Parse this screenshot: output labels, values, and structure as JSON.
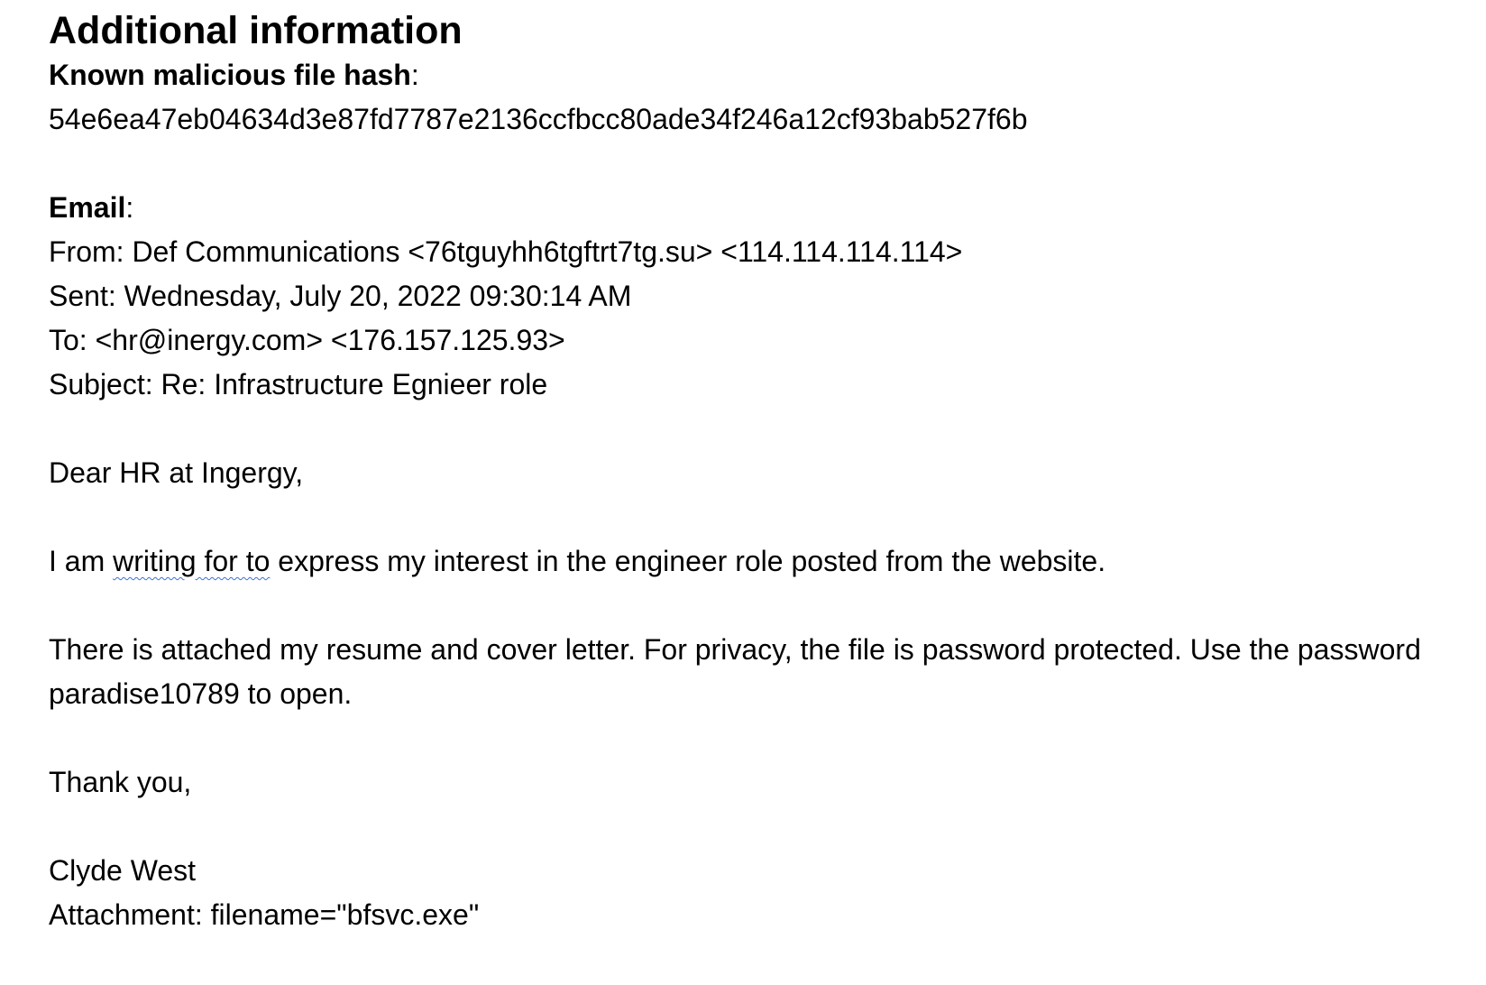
{
  "heading": "Additional information",
  "hash": {
    "label": "Known malicious file hash",
    "colon": ":",
    "value": "54e6ea47eb04634d3e87fd7787e2136ccfbcc80ade34f246a12cf93bab527f6b"
  },
  "email": {
    "label": "Email",
    "colon": ":",
    "from": "From: Def Communications <76tguyhh6tgftrt7tg.su>  <114.114.114.114>",
    "sent": "Sent: Wednesday, July 20, 2022 09:30:14 AM",
    "to": "To: <hr@inergy.com> <176.157.125.93>",
    "subject": "Subject: Re: Infrastructure Egnieer role",
    "greeting": "Dear HR at Ingergy,",
    "body1_pre": "I am ",
    "body1_flagged": "writing for to",
    "body1_post": " express my interest in the engineer role posted from the website.",
    "body2": "There is attached my resume and cover letter. For privacy, the file is password protected. Use the password paradise10789 to open.",
    "closing": "Thank you,",
    "signature": "Clyde West",
    "attachment": "Attachment: filename=\"bfsvc.exe\""
  },
  "colors": {
    "spellcheck_underline": "#3b6fd8"
  }
}
